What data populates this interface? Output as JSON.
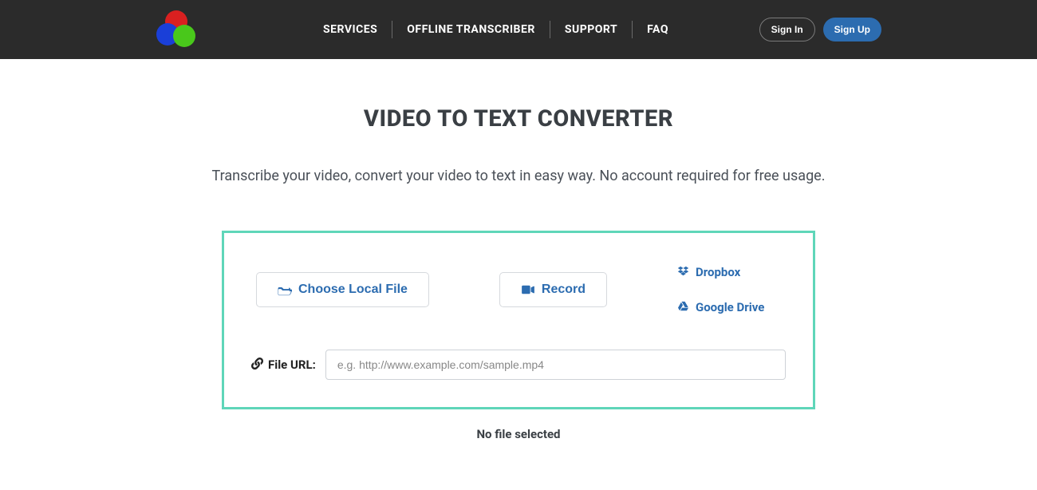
{
  "nav": {
    "services": "SERVICES",
    "offline": "OFFLINE TRANSCRIBER",
    "support": "SUPPORT",
    "faq": "FAQ",
    "signin": "Sign In",
    "signup": "Sign Up"
  },
  "page": {
    "title": "VIDEO TO TEXT CONVERTER",
    "subtitle": "Transcribe your video, convert your video to text in easy way. No account required for free usage."
  },
  "upload": {
    "choose_local": "Choose Local File",
    "record": "Record",
    "dropbox": "Dropbox",
    "gdrive": "Google Drive",
    "url_label": "File URL:",
    "url_placeholder": "e.g. http://www.example.com/sample.mp4",
    "no_file": "No file selected"
  }
}
